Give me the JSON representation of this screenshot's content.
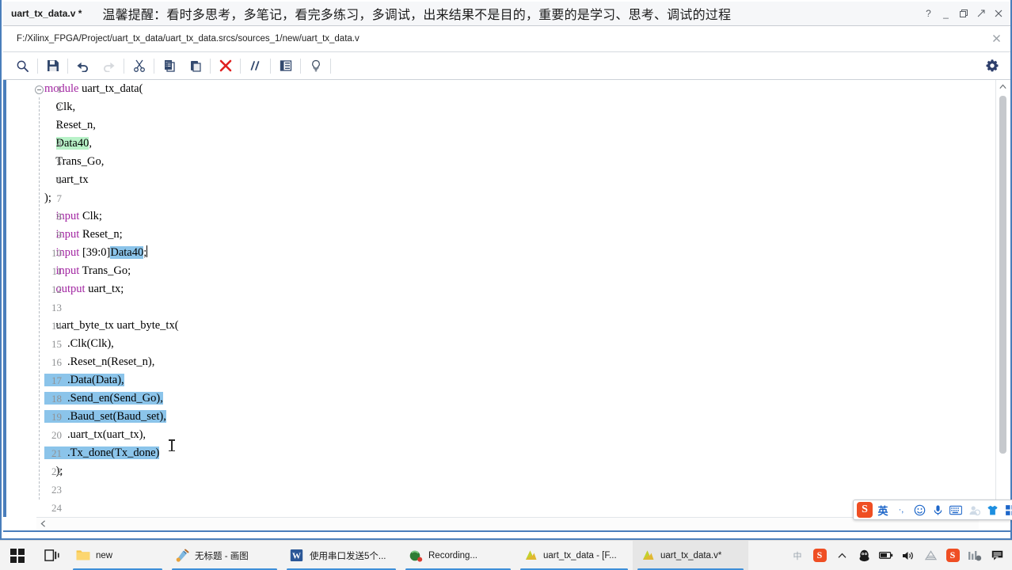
{
  "window": {
    "tab_title": "uart_tx_data.v *",
    "banner": "温馨提醒：看时多思考，多笔记，看完多练习，多调试，出来结果不是目的，重要的是学习、思考、调试的过程",
    "controls": [
      {
        "name": "help",
        "glyph": "?"
      },
      {
        "name": "minimize",
        "glyph": "_"
      },
      {
        "name": "restore",
        "glyph": "❐"
      },
      {
        "name": "float",
        "glyph": "⇱"
      },
      {
        "name": "close",
        "glyph": "✕"
      }
    ],
    "file_path": "F:/Xilinx_FPGA/Project/uart_tx_data/uart_tx_data.srcs/sources_1/new/uart_tx_data.v",
    "path_close_glyph": "✕"
  },
  "toolbar": {
    "buttons": [
      {
        "name": "find-icon",
        "label": "Find",
        "enabled": true
      },
      {
        "name": "save-icon",
        "label": "Save File",
        "enabled": true
      },
      {
        "name": "undo-icon",
        "label": "Undo",
        "enabled": true
      },
      {
        "name": "redo-icon",
        "label": "Redo",
        "enabled": false
      },
      {
        "name": "cut-icon",
        "label": "Cut",
        "enabled": true
      },
      {
        "name": "copy-icon",
        "label": "Copy",
        "enabled": true
      },
      {
        "name": "paste-icon",
        "label": "Paste",
        "enabled": true
      },
      {
        "name": "delete-icon",
        "label": "Delete",
        "enabled": true
      },
      {
        "name": "comment-icon",
        "label": "Toggle Comment",
        "enabled": true
      },
      {
        "name": "indent-icon",
        "label": "Indent",
        "enabled": true
      },
      {
        "name": "bulb-icon",
        "label": "Hints",
        "enabled": true
      }
    ],
    "settings_label": "Settings"
  },
  "editor": {
    "lines": [
      {
        "n": "1",
        "indent": 0,
        "segs": [
          {
            "t": "module ",
            "c": "kw"
          },
          {
            "t": "uart_tx_data("
          }
        ],
        "fold": true
      },
      {
        "n": "2",
        "indent": 0,
        "segs": [
          {
            "t": "    Clk,"
          }
        ]
      },
      {
        "n": "3",
        "indent": 0,
        "segs": [
          {
            "t": "    Reset_n,"
          }
        ]
      },
      {
        "n": "4",
        "indent": 0,
        "segs": [
          {
            "t": "    Data40",
            "c": "hl-green",
            "pre": "    "
          },
          {
            "t": ","
          }
        ]
      },
      {
        "n": "5",
        "indent": 0,
        "segs": [
          {
            "t": "    Trans_Go,"
          }
        ]
      },
      {
        "n": "6",
        "indent": 0,
        "segs": [
          {
            "t": "    uart_tx"
          }
        ]
      },
      {
        "n": "7",
        "indent": 0,
        "segs": [
          {
            "t": ");"
          }
        ]
      },
      {
        "n": "8",
        "indent": 0,
        "segs": [
          {
            "t": "    input",
            "c": "kw"
          },
          {
            "t": " Clk;"
          }
        ]
      },
      {
        "n": "9",
        "indent": 0,
        "segs": [
          {
            "t": "    input",
            "c": "kw"
          },
          {
            "t": " Reset_n;"
          }
        ]
      },
      {
        "n": "10",
        "indent": 0,
        "segs": [
          {
            "t": "    input",
            "c": "kw"
          },
          {
            "t": " [39:0]"
          },
          {
            "t": "Data40",
            "c": "hl-blue"
          },
          {
            "t": ";",
            "caret": true
          }
        ]
      },
      {
        "n": "11",
        "indent": 0,
        "segs": [
          {
            "t": "    input",
            "c": "kw"
          },
          {
            "t": " Trans_Go;"
          }
        ]
      },
      {
        "n": "12",
        "indent": 0,
        "segs": [
          {
            "t": "    output",
            "c": "kw"
          },
          {
            "t": " uart_tx;"
          }
        ]
      },
      {
        "n": "13",
        "indent": 0,
        "segs": [
          {
            "t": ""
          }
        ]
      },
      {
        "n": "14",
        "indent": 0,
        "segs": [
          {
            "t": "    uart_byte_tx uart_byte_tx("
          }
        ]
      },
      {
        "n": "15",
        "indent": 0,
        "segs": [
          {
            "t": "        .Clk(Clk),"
          }
        ]
      },
      {
        "n": "16",
        "indent": 0,
        "segs": [
          {
            "t": "        .Reset_n(Reset_n),"
          }
        ]
      },
      {
        "n": "17",
        "indent": 0,
        "segs": [
          {
            "t": "        .Data(Data),",
            "c": "hl-blue",
            "rowsel": 150
          }
        ]
      },
      {
        "n": "18",
        "indent": 0,
        "segs": [
          {
            "t": "        .Send_en(Send_Go),",
            "c": "hl-blue",
            "rowsel": 193
          }
        ]
      },
      {
        "n": "19",
        "indent": 0,
        "segs": [
          {
            "t": "        .Baud_set(Baud_set),",
            "c": "hl-blue",
            "rowsel": 210
          }
        ]
      },
      {
        "n": "20",
        "indent": 0,
        "segs": [
          {
            "t": "        .uart_tx(uart_tx),"
          }
        ]
      },
      {
        "n": "21",
        "indent": 0,
        "segs": [
          {
            "t": "        .Tx_done(Tx_done)",
            "c": "hl-blue",
            "rowsel": 186
          }
        ]
      },
      {
        "n": "22",
        "indent": 0,
        "segs": [
          {
            "t": "    );"
          }
        ]
      },
      {
        "n": "23",
        "indent": 0,
        "segs": [
          {
            "t": ""
          }
        ]
      },
      {
        "n": "24",
        "indent": 0,
        "segs": [
          {
            "t": ""
          }
        ]
      }
    ],
    "colors": {
      "keyword": "#a226a2",
      "selection": "#8bc4ea",
      "match_highlight": "#b8f2c8",
      "accent": "#4a7ebb"
    }
  },
  "ime": {
    "items": [
      {
        "name": "sogou-logo-icon",
        "glyph": "S"
      },
      {
        "name": "language-mode-icon",
        "glyph": "英"
      },
      {
        "name": "punctuation-mode-icon",
        "glyph": "·,"
      },
      {
        "name": "emoji-icon",
        "glyph": "☺"
      },
      {
        "name": "voice-input-icon",
        "glyph": "🎤"
      },
      {
        "name": "soft-keyboard-icon",
        "glyph": "⌨"
      },
      {
        "name": "user-account-icon",
        "glyph": "👤"
      },
      {
        "name": "skin-icon",
        "glyph": "👕"
      },
      {
        "name": "toolbox-icon",
        "glyph": "▦"
      }
    ]
  },
  "taskbar": {
    "start_label": "Start",
    "taskview_label": "Task View",
    "items": [
      {
        "name": "taskbar-item-explorer",
        "label": "new",
        "icon": "folder-icon",
        "active": false
      },
      {
        "name": "taskbar-item-paint",
        "label": "无标题 - 画图",
        "icon": "paint-icon",
        "active": false
      },
      {
        "name": "taskbar-item-word",
        "label": "使用串口发送5个...",
        "icon": "word-icon",
        "active": false
      },
      {
        "name": "taskbar-item-recording",
        "label": "Recording...",
        "icon": "recorder-icon",
        "active": false
      },
      {
        "name": "taskbar-item-vivado-project",
        "label": "uart_tx_data - [F...",
        "icon": "vivado-icon",
        "active": false
      },
      {
        "name": "taskbar-item-vivado-editor",
        "label": "uart_tx_data.v*",
        "icon": "vivado-icon",
        "active": true
      }
    ],
    "tray": [
      {
        "name": "ime-status-icon",
        "glyph": "中"
      },
      {
        "name": "sogou-tray-icon",
        "glyph": "S"
      },
      {
        "name": "show-hidden-icons-icon",
        "glyph": "⌃"
      },
      {
        "name": "qq-icon",
        "glyph": "🐧"
      },
      {
        "name": "battery-icon",
        "glyph": "🔋"
      },
      {
        "name": "volume-icon",
        "glyph": "🔊"
      },
      {
        "name": "network-icon",
        "glyph": "▨"
      },
      {
        "name": "sogou-input-icon",
        "glyph": "S"
      },
      {
        "name": "media-icon",
        "glyph": "▮▮"
      },
      {
        "name": "notifications-icon",
        "glyph": "🗨"
      }
    ]
  }
}
